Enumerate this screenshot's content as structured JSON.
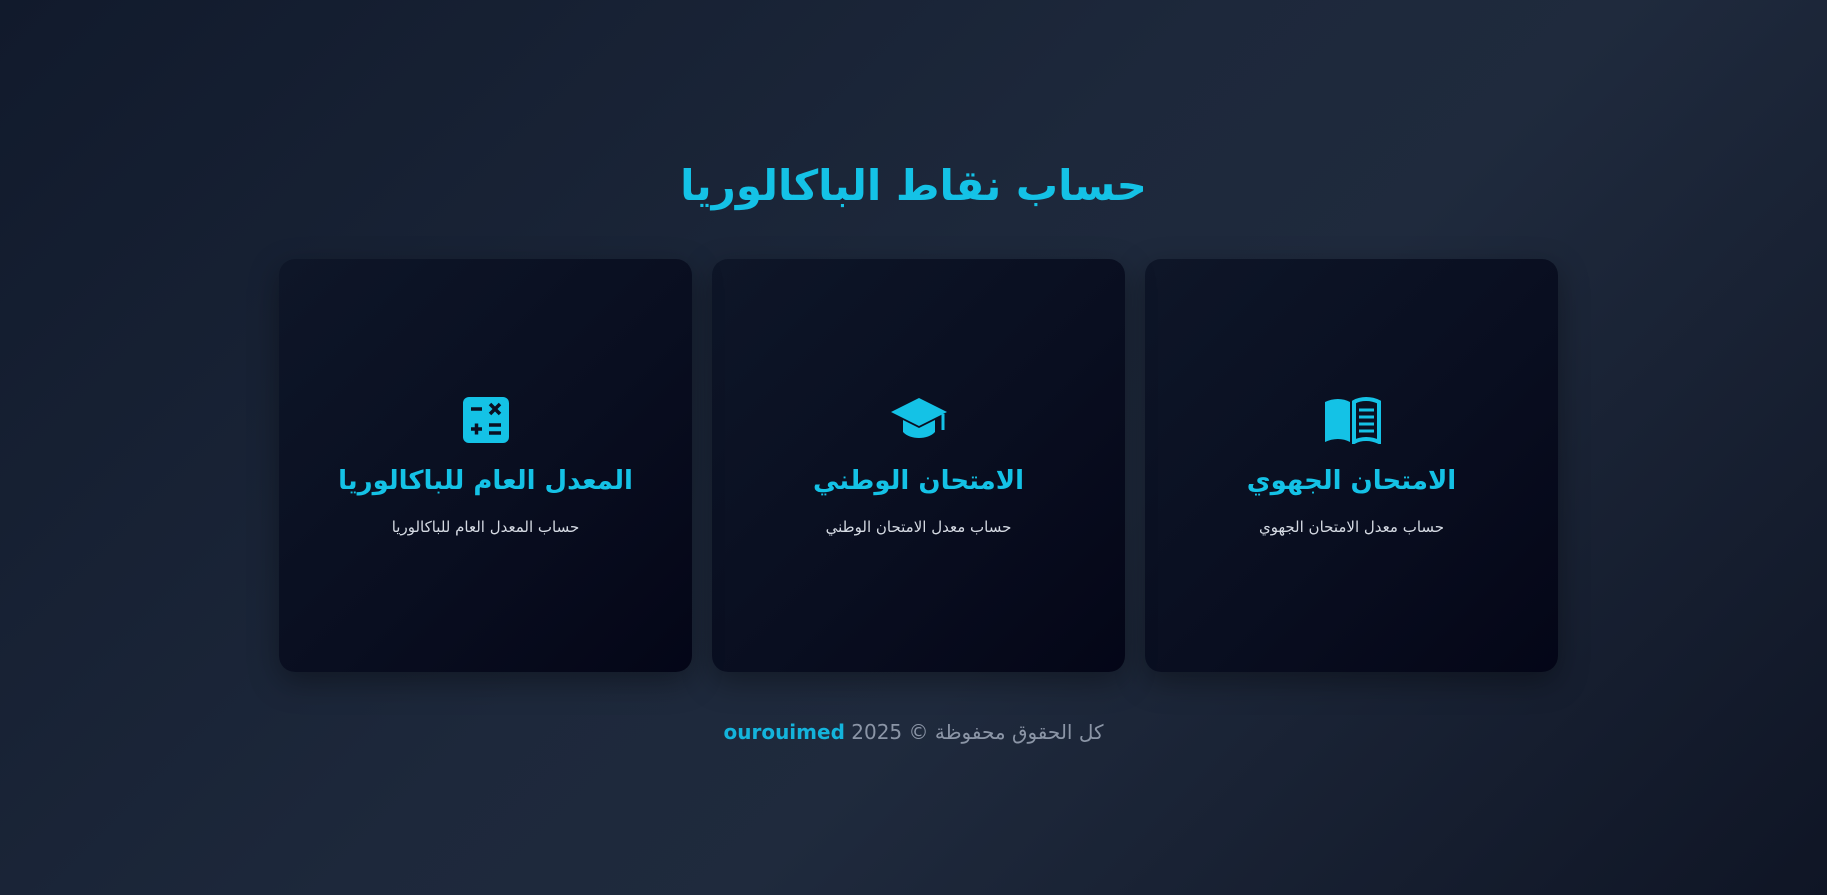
{
  "page": {
    "title": "حساب نقاط الباكالوريا"
  },
  "cards": [
    {
      "icon": "open-book-icon",
      "title": "الامتحان الجهوي",
      "description": "حساب معدل الامتحان الجهوي"
    },
    {
      "icon": "graduation-cap-icon",
      "title": "الامتحان الوطني",
      "description": "حساب معدل الامتحان الوطني"
    },
    {
      "icon": "calculator-icon",
      "title": "المعدل العام للباكالوريا",
      "description": "حساب المعدل العام للباكالوريا"
    }
  ],
  "footer": {
    "text": "كل الحقوق محفوظة © 2025",
    "brand": "ourouimed"
  },
  "colors": {
    "accent": "#14c2e6",
    "background": "#1d283b",
    "card": "#090e20",
    "muted_text": "#8b95a6"
  }
}
